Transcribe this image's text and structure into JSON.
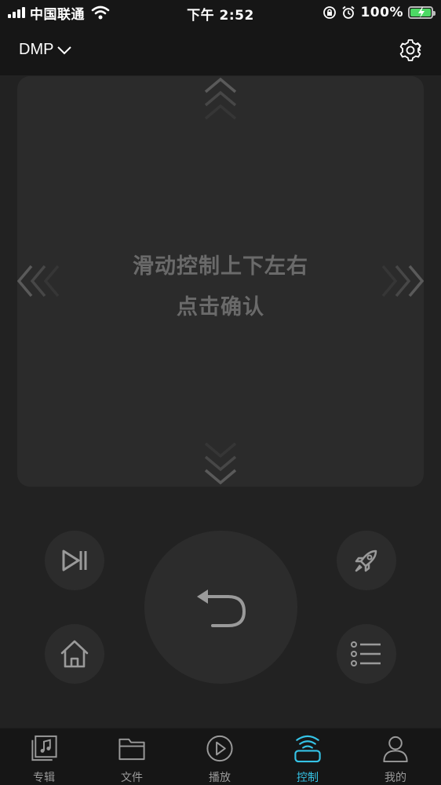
{
  "status_bar": {
    "carrier": "中国联通",
    "time": "下午 2:52",
    "battery": "100%"
  },
  "header": {
    "device_name": "DMP"
  },
  "touchpad": {
    "line1": "滑动控制上下左右",
    "line2": "点击确认"
  },
  "controls": {
    "play_pause_icon": "play-pause-icon",
    "launch_icon": "rocket-icon",
    "home_icon": "home-icon",
    "menu_icon": "list-icon",
    "back_icon": "return-arrow-icon"
  },
  "tabs": [
    {
      "label": "专辑",
      "icon": "album-icon",
      "active": false
    },
    {
      "label": "文件",
      "icon": "folder-icon",
      "active": false
    },
    {
      "label": "播放",
      "icon": "play-icon",
      "active": false
    },
    {
      "label": "控制",
      "icon": "remote-control-icon",
      "active": true
    },
    {
      "label": "我的",
      "icon": "person-icon",
      "active": false
    }
  ],
  "colors": {
    "background": "#222222",
    "bar": "#161616",
    "pad": "#2b2b2b",
    "accent": "#35c3e6",
    "battery": "#4cd964"
  }
}
